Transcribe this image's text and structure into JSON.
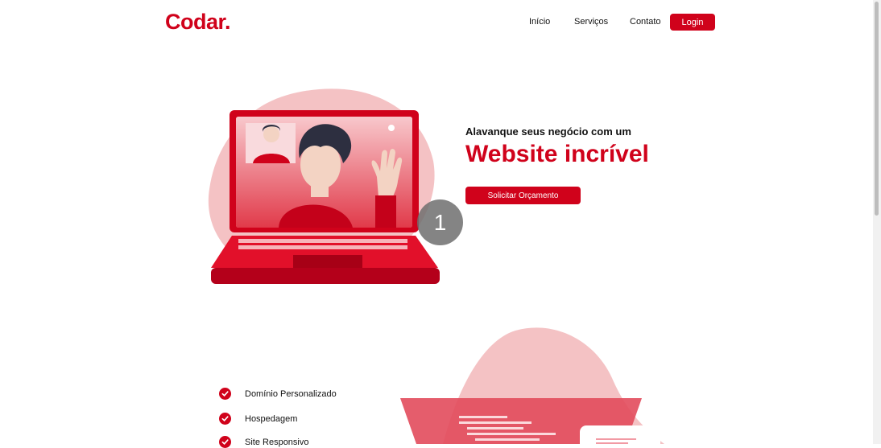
{
  "header": {
    "logo": "Codar.",
    "nav": [
      {
        "label": "Início"
      },
      {
        "label": "Serviços"
      },
      {
        "label": "Contato"
      }
    ],
    "login_label": "Login"
  },
  "hero": {
    "subtitle": "Alavanque seus negócio com um",
    "title": "Website incrível",
    "cta_label": "Solicitar Orçamento",
    "step_number": "1"
  },
  "features": [
    {
      "label": "Domínio Personalizado"
    },
    {
      "label": "Hospedagem"
    },
    {
      "label": "Site Responsivo"
    }
  ],
  "colors": {
    "accent": "#d0021b",
    "blob": "#f4c2c4"
  },
  "icons": [
    "laptop-illustration",
    "check-icon",
    "code-illustration"
  ]
}
